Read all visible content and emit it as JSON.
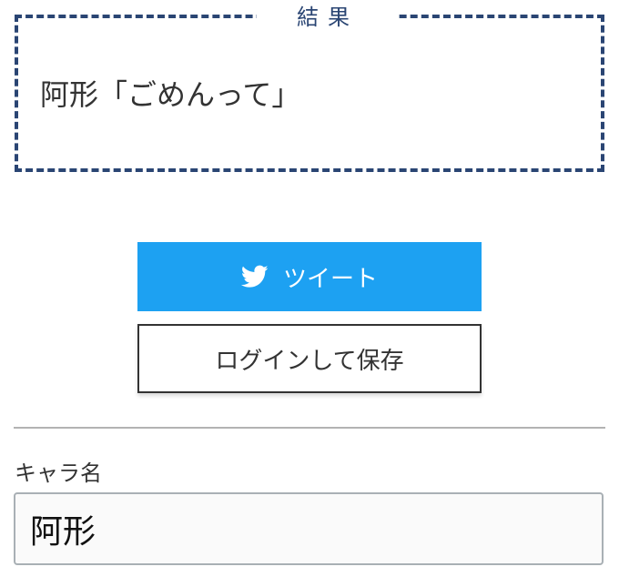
{
  "result": {
    "legend": "結果",
    "text": "阿形「ごめんって」"
  },
  "buttons": {
    "tweet_label": "ツイート",
    "tweet_icon": "twitter-bird-icon",
    "login_save_label": "ログインして保存"
  },
  "form": {
    "character_name_label": "キャラ名",
    "character_name_value": "阿形"
  },
  "colors": {
    "accent_navy": "#2a4573",
    "twitter_blue": "#1da1f2"
  }
}
